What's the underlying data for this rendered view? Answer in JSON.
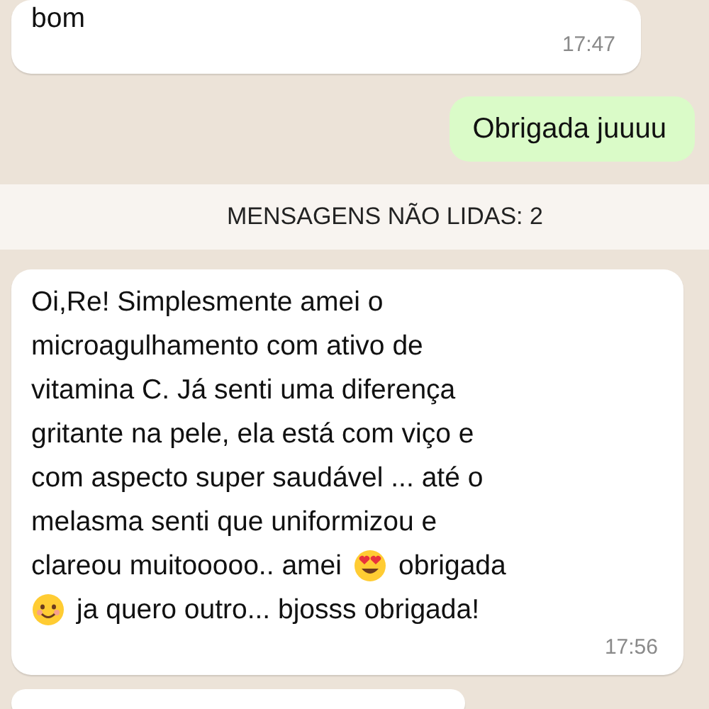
{
  "messages": [
    {
      "kind": "incoming",
      "lines": [
        [
          {
            "kind": "text",
            "text": "bom"
          }
        ]
      ],
      "time": "17:47"
    },
    {
      "kind": "outgoing",
      "lines": [
        [
          {
            "kind": "text",
            "text": "Obrigada juuuu"
          }
        ]
      ]
    },
    {
      "kind": "banner",
      "text": "MENSAGENS NÃO LIDAS: 2"
    },
    {
      "kind": "incoming",
      "lines": [
        [
          {
            "kind": "text",
            "text": "Oi,Re! Simplesmente amei o"
          }
        ],
        [
          {
            "kind": "text",
            "text": "microagulhamento com ativo de"
          }
        ],
        [
          {
            "kind": "text",
            "text": "vitamina C. Já senti uma diferença"
          }
        ],
        [
          {
            "kind": "text",
            "text": "gritante na pele, ela está com viço e"
          }
        ],
        [
          {
            "kind": "text",
            "text": "com aspecto super saudável ... até o"
          }
        ],
        [
          {
            "kind": "text",
            "text": "melasma senti que uniformizou e"
          }
        ],
        [
          {
            "kind": "text",
            "text": "clareou muitooooo.. amei"
          },
          {
            "kind": "heart-eyes"
          },
          {
            "kind": "text",
            "text": "obrigada"
          }
        ],
        [
          {
            "kind": "smile"
          },
          {
            "kind": "text",
            "text": "ja quero outro... bjosss obrigada!"
          }
        ]
      ],
      "time": "17:56"
    },
    {
      "kind": "partial"
    }
  ]
}
